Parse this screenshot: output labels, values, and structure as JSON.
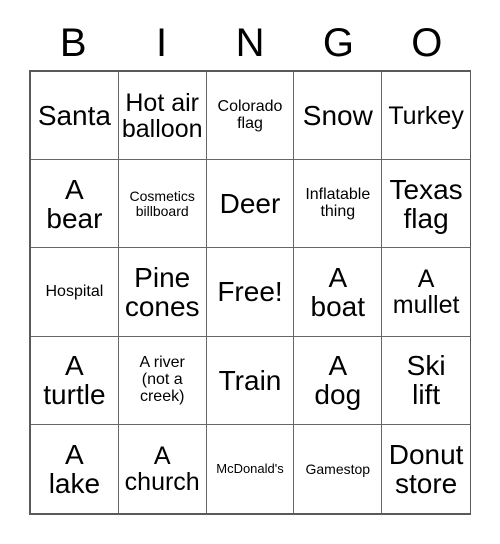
{
  "card": {
    "headers": [
      "B",
      "I",
      "N",
      "G",
      "O"
    ],
    "rows": [
      [
        {
          "text": "Santa",
          "size": "fs-xl"
        },
        {
          "text": "Hot air\nballoon",
          "size": "fs-lg"
        },
        {
          "text": "Colorado\nflag",
          "size": "fs-sm"
        },
        {
          "text": "Snow",
          "size": "fs-xl"
        },
        {
          "text": "Turkey",
          "size": "fs-lg"
        }
      ],
      [
        {
          "text": "A\nbear",
          "size": "fs-xl"
        },
        {
          "text": "Cosmetics\nbillboard",
          "size": "fs-xs"
        },
        {
          "text": "Deer",
          "size": "fs-xl"
        },
        {
          "text": "Inflatable\nthing",
          "size": "fs-sm"
        },
        {
          "text": "Texas\nflag",
          "size": "fs-xl"
        }
      ],
      [
        {
          "text": "Hospital",
          "size": "fs-sm"
        },
        {
          "text": "Pine\ncones",
          "size": "fs-xl"
        },
        {
          "text": "Free!",
          "size": "fs-xl"
        },
        {
          "text": "A\nboat",
          "size": "fs-xl"
        },
        {
          "text": "A\nmullet",
          "size": "fs-lg"
        }
      ],
      [
        {
          "text": "A\nturtle",
          "size": "fs-xl"
        },
        {
          "text": "A river\n(not a\ncreek)",
          "size": "fs-sm"
        },
        {
          "text": "Train",
          "size": "fs-xl"
        },
        {
          "text": "A\ndog",
          "size": "fs-xl"
        },
        {
          "text": "Ski\nlift",
          "size": "fs-xl"
        }
      ],
      [
        {
          "text": "A\nlake",
          "size": "fs-xl"
        },
        {
          "text": "A\nchurch",
          "size": "fs-lg"
        },
        {
          "text": "McDonald's",
          "size": "fs-xxs"
        },
        {
          "text": "Gamestop",
          "size": "fs-xs"
        },
        {
          "text": "Donut\nstore",
          "size": "fs-xl"
        }
      ]
    ]
  }
}
